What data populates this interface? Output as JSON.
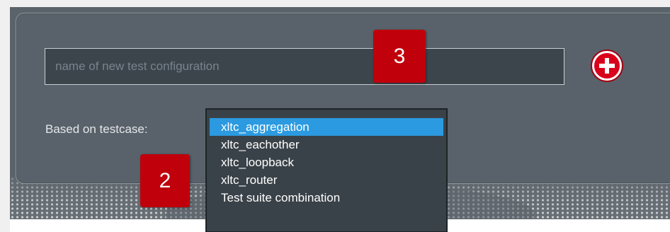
{
  "form": {
    "name_placeholder": "name of new test configuration",
    "name_value": "",
    "based_on_label": "Based on testcase:",
    "add_button_icon": "plus-circle-icon"
  },
  "dropdown": {
    "options": [
      {
        "label": "xltc_aggregation",
        "selected": true
      },
      {
        "label": "xltc_eachother",
        "selected": false
      },
      {
        "label": "xltc_loopback",
        "selected": false
      },
      {
        "label": "xltc_router",
        "selected": false
      },
      {
        "label": "Test suite combination",
        "selected": false
      }
    ]
  },
  "annotations": {
    "badge_3": "3",
    "badge_2": "2"
  },
  "colors": {
    "panel_bg": "#59626a",
    "input_bg": "#3d454c",
    "selection_blue": "#2b9ae0",
    "badge_red": "#c0000b",
    "add_red": "#d9001b"
  }
}
